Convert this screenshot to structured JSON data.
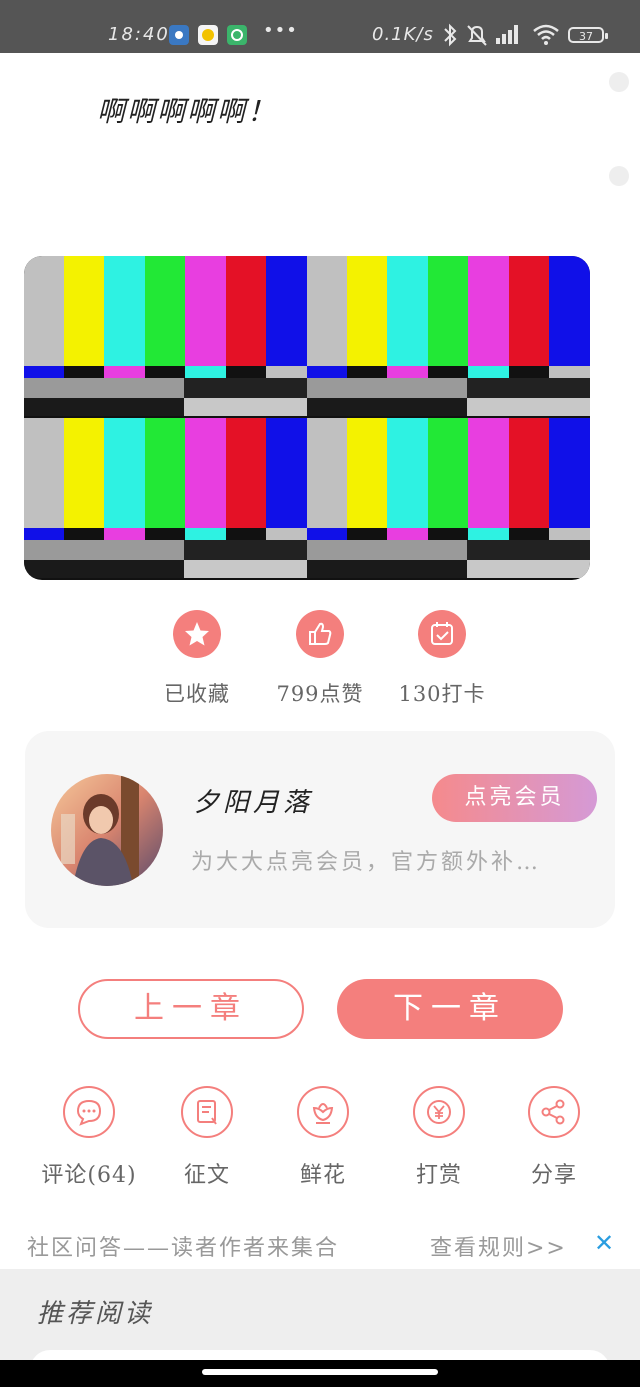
{
  "status_bar": {
    "time": "18:40",
    "dots": "•••",
    "speed": "0.1K/s",
    "battery": "37",
    "icons": [
      "settings-app-icon",
      "chat-app-icon",
      "green-app-icon",
      "bluetooth-icon",
      "mute-bell-icon",
      "signal-icon",
      "wifi-icon",
      "battery-icon"
    ]
  },
  "post": {
    "headline": "啊啊啊啊啊！"
  },
  "actions": [
    {
      "label": "已收藏",
      "icon": "star-icon"
    },
    {
      "label": "799点赞",
      "icon": "thumbs-up-icon"
    },
    {
      "label": "130打卡",
      "icon": "checkin-calendar-icon"
    }
  ],
  "author": {
    "name": "夕阳月落",
    "vip_button": "点亮会员",
    "description": "为大大点亮会员，官方额外补…"
  },
  "chapter_nav": {
    "prev": "上一章",
    "next": "下一章"
  },
  "bottom_actions": [
    {
      "label": "评论(64)",
      "icon": "comment-icon"
    },
    {
      "label": "征文",
      "icon": "essay-scroll-icon"
    },
    {
      "label": "鲜花",
      "icon": "flower-icon"
    },
    {
      "label": "打赏",
      "icon": "yen-coin-icon"
    },
    {
      "label": "分享",
      "icon": "share-icon"
    }
  ],
  "community": {
    "text": "社区问答——读者作者来集合",
    "rules_link": "查看规则>>",
    "close": "✕"
  },
  "recommended": {
    "title": "推荐阅读"
  },
  "colors": {
    "accent": "#f47f7d",
    "status_bar": "#555555",
    "close_blue": "#2a9de0"
  }
}
